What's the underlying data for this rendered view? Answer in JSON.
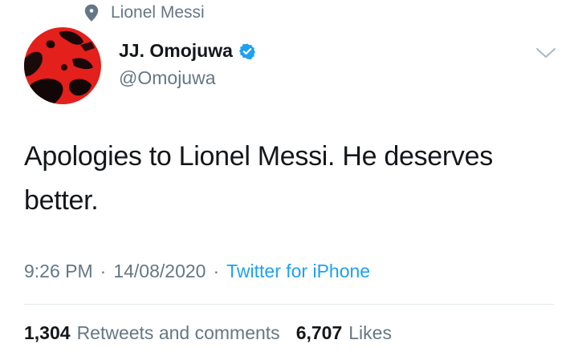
{
  "context": {
    "icon": "location-pin-icon",
    "label": "Lionel Messi"
  },
  "author": {
    "display_name": "JJ. Omojuwa",
    "handle": "@Omojuwa",
    "verified": true,
    "avatar": "profile-avatar"
  },
  "tweet": {
    "text": "Apologies to Lionel Messi. He deserves better."
  },
  "meta": {
    "time": "9:26 PM",
    "separator": "·",
    "date": "14/08/2020",
    "source": "Twitter for iPhone"
  },
  "stats": {
    "retweets_count": "1,304",
    "retweets_label": "Retweets and comments",
    "likes_count": "6,707",
    "likes_label": "Likes"
  },
  "colors": {
    "text_primary": "#14171a",
    "text_secondary": "#657786",
    "link": "#1da1f2",
    "verified": "#1da1f2",
    "divider": "#e1e8ed"
  }
}
